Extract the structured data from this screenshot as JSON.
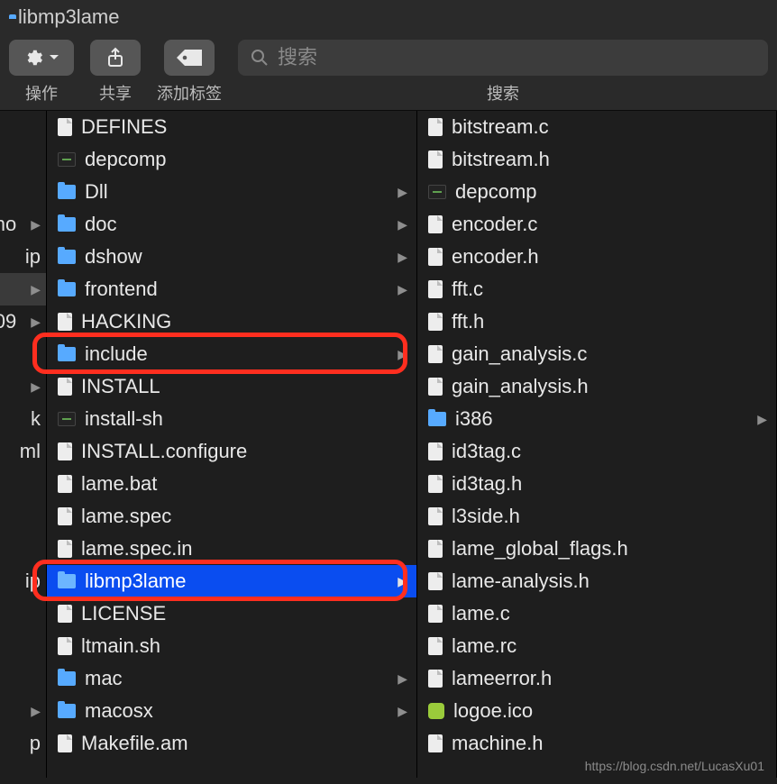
{
  "window": {
    "title": "libmp3lame"
  },
  "toolbar": {
    "actions_label": "操作",
    "share_label": "共享",
    "tags_label": "添加标签",
    "search_label": "搜索"
  },
  "search": {
    "placeholder": "搜索"
  },
  "col0": {
    "items": [
      {
        "label": "",
        "chevron": false
      },
      {
        "label": "",
        "chevron": false
      },
      {
        "label": "",
        "chevron": false
      },
      {
        "label": "no",
        "chevron": true
      },
      {
        "label": "ip",
        "chevron": false
      },
      {
        "label": "",
        "chevron": true,
        "greyed": true
      },
      {
        "label": "09",
        "chevron": true
      },
      {
        "label": "",
        "chevron": false
      },
      {
        "label": "",
        "chevron": true
      },
      {
        "label": "k",
        "chevron": false
      },
      {
        "label": "ml",
        "chevron": false
      },
      {
        "label": "",
        "chevron": false
      },
      {
        "label": "",
        "chevron": false
      },
      {
        "label": "",
        "chevron": false
      },
      {
        "label": "ip",
        "chevron": false
      },
      {
        "label": "",
        "chevron": false
      },
      {
        "label": "",
        "chevron": false
      },
      {
        "label": "",
        "chevron": false
      },
      {
        "label": "",
        "chevron": true
      },
      {
        "label": "p",
        "chevron": false
      }
    ]
  },
  "col1": {
    "items": [
      {
        "type": "file",
        "name": "DEFINES"
      },
      {
        "type": "exec",
        "name": "depcomp"
      },
      {
        "type": "folder",
        "name": "Dll",
        "chevron": true
      },
      {
        "type": "folder",
        "name": "doc",
        "chevron": true
      },
      {
        "type": "folder",
        "name": "dshow",
        "chevron": true
      },
      {
        "type": "folder",
        "name": "frontend",
        "chevron": true
      },
      {
        "type": "file",
        "name": "HACKING"
      },
      {
        "type": "folder",
        "name": "include",
        "chevron": true,
        "highlight": true
      },
      {
        "type": "file",
        "name": "INSTALL"
      },
      {
        "type": "exec",
        "name": "install-sh"
      },
      {
        "type": "file",
        "name": "INSTALL.configure"
      },
      {
        "type": "file",
        "name": "lame.bat"
      },
      {
        "type": "file",
        "name": "lame.spec"
      },
      {
        "type": "file",
        "name": "lame.spec.in"
      },
      {
        "type": "folder",
        "name": "libmp3lame",
        "chevron": true,
        "selected": true,
        "highlight": true
      },
      {
        "type": "file",
        "name": "LICENSE"
      },
      {
        "type": "file",
        "name": "ltmain.sh"
      },
      {
        "type": "folder",
        "name": "mac",
        "chevron": true
      },
      {
        "type": "folder",
        "name": "macosx",
        "chevron": true
      },
      {
        "type": "file",
        "name": "Makefile.am"
      }
    ]
  },
  "col2": {
    "items": [
      {
        "type": "file",
        "name": "bitstream.c"
      },
      {
        "type": "file",
        "name": "bitstream.h"
      },
      {
        "type": "exec",
        "name": "depcomp"
      },
      {
        "type": "file",
        "name": "encoder.c"
      },
      {
        "type": "file",
        "name": "encoder.h"
      },
      {
        "type": "file",
        "name": "fft.c"
      },
      {
        "type": "file",
        "name": "fft.h"
      },
      {
        "type": "file",
        "name": "gain_analysis.c"
      },
      {
        "type": "file",
        "name": "gain_analysis.h"
      },
      {
        "type": "folder",
        "name": "i386",
        "chevron": true
      },
      {
        "type": "file",
        "name": "id3tag.c"
      },
      {
        "type": "file",
        "name": "id3tag.h"
      },
      {
        "type": "file",
        "name": "l3side.h"
      },
      {
        "type": "file",
        "name": "lame_global_flags.h"
      },
      {
        "type": "file",
        "name": "lame-analysis.h"
      },
      {
        "type": "file",
        "name": "lame.c"
      },
      {
        "type": "file",
        "name": "lame.rc"
      },
      {
        "type": "file",
        "name": "lameerror.h"
      },
      {
        "type": "ico",
        "name": "logoe.ico"
      },
      {
        "type": "file",
        "name": "machine.h"
      }
    ]
  },
  "watermark": "https://blog.csdn.net/LucasXu01"
}
